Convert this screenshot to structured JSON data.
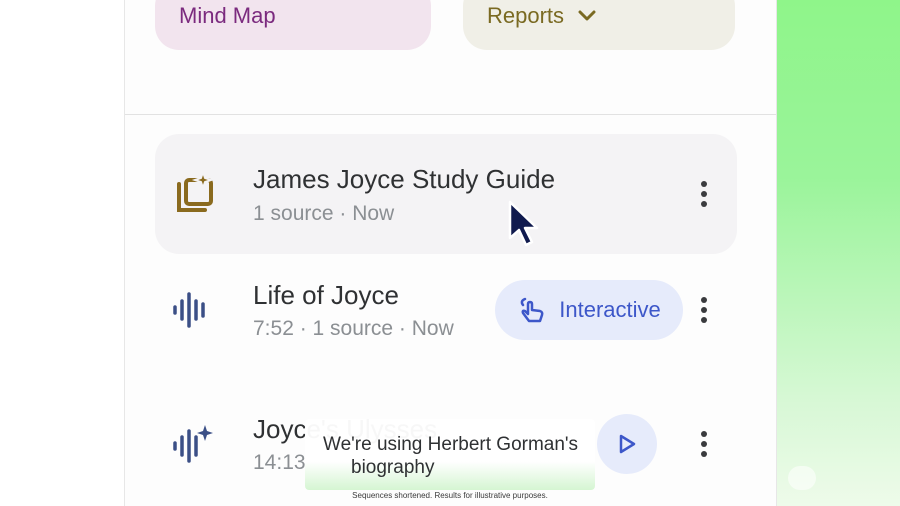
{
  "top_buttons": {
    "mind_map": "Mind Map",
    "reports": "Reports"
  },
  "items": [
    {
      "title": "James Joyce Study Guide",
      "subtitle": "1 source · Now",
      "icon": "study-guide-icon"
    },
    {
      "title": "Life of Joyce",
      "subtitle": "7:52 · 1 source · Now",
      "icon": "audio-waveform-icon",
      "badge": "Interactive"
    },
    {
      "title": "Joyce's Ulysses",
      "subtitle": "14:13",
      "icon": "audio-sparkle-icon"
    }
  ],
  "caption": {
    "line1": "We're using Herbert Gorman's",
    "line2": "biography"
  },
  "disclaimer": "Sequences shortened. Results for illustrative purposes.",
  "colors": {
    "mind_map_bg": "#f2e4ee",
    "reports_bg": "#f0efe7",
    "interactive_bg": "#e6ebfb",
    "accent_blue": "#3d57c9"
  }
}
